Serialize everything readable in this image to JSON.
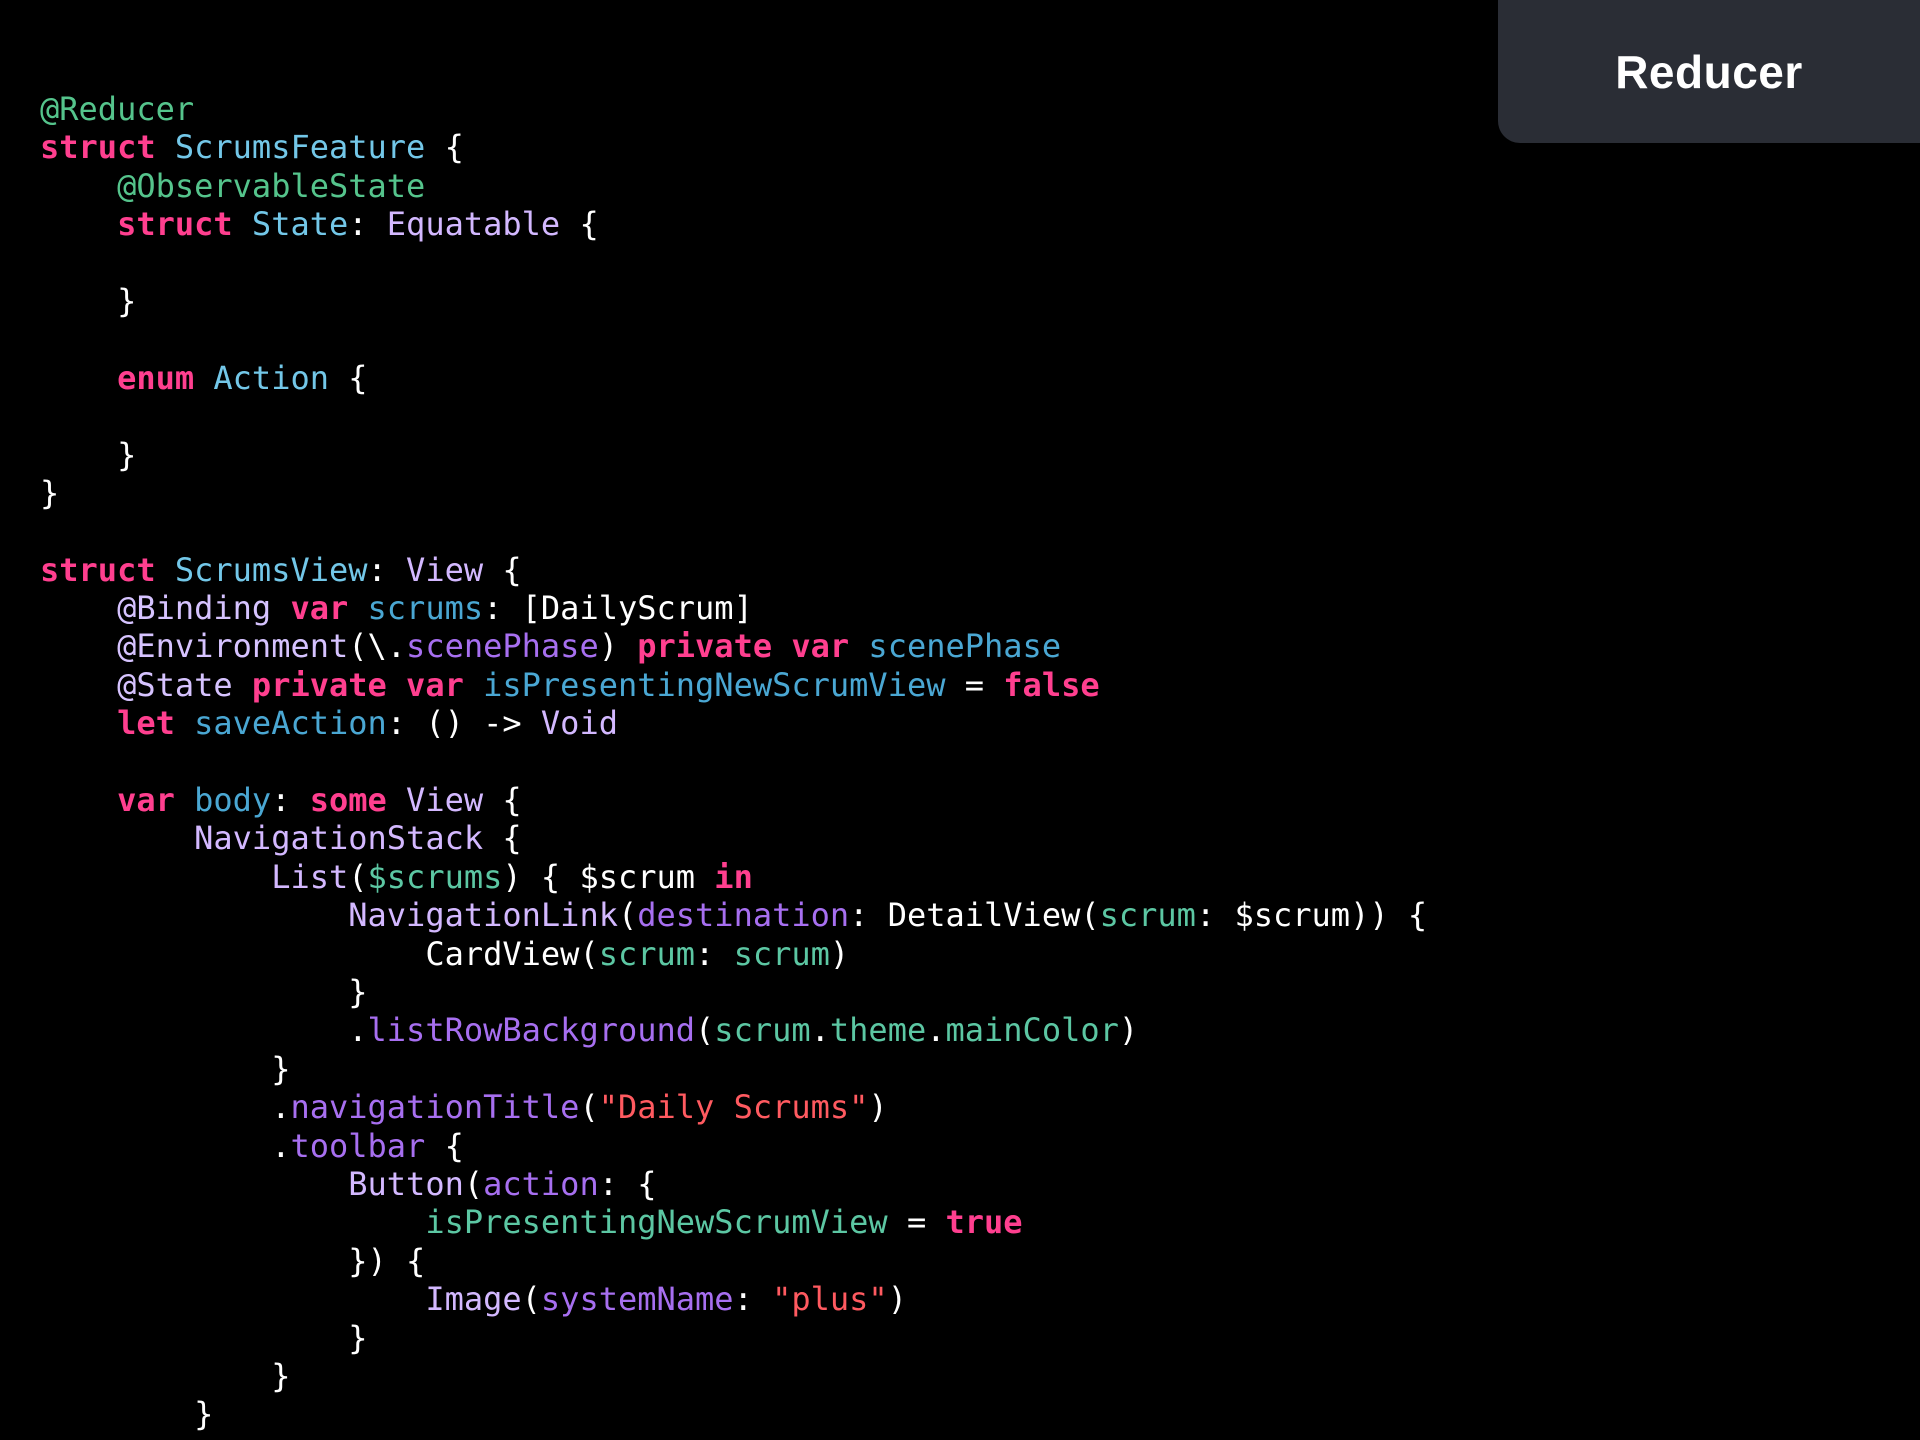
{
  "header": {
    "title": "Reducer"
  },
  "colors": {
    "background": "#000000",
    "badge_background": "#2a2d35",
    "keyword": "#ff3f8f",
    "decorator": "#55c48c",
    "attribute": "#d6c3ff",
    "type_declared": "#73c7e8",
    "type_system": "#d3b8ff",
    "identifier": "#4aa7d3",
    "function": "#a76ff0",
    "variable": "#5cc7a3",
    "string": "#ff5a60",
    "plain": "#ffffff"
  },
  "code": {
    "lines": [
      [
        {
          "t": "@Reducer",
          "c": "dec"
        }
      ],
      [
        {
          "t": "struct",
          "c": "kw"
        },
        {
          "t": " ",
          "c": "pln"
        },
        {
          "t": "ScrumsFeature",
          "c": "typ"
        },
        {
          "t": " {",
          "c": "pln"
        }
      ],
      [
        {
          "t": "    ",
          "c": "pln"
        },
        {
          "t": "@ObservableState",
          "c": "dec"
        }
      ],
      [
        {
          "t": "    ",
          "c": "pln"
        },
        {
          "t": "struct",
          "c": "kw"
        },
        {
          "t": " ",
          "c": "pln"
        },
        {
          "t": "State",
          "c": "typ"
        },
        {
          "t": ": ",
          "c": "pln"
        },
        {
          "t": "Equatable",
          "c": "std"
        },
        {
          "t": " {",
          "c": "pln"
        }
      ],
      [],
      [
        {
          "t": "    }",
          "c": "pln"
        }
      ],
      [],
      [
        {
          "t": "    ",
          "c": "pln"
        },
        {
          "t": "enum",
          "c": "kw"
        },
        {
          "t": " ",
          "c": "pln"
        },
        {
          "t": "Action",
          "c": "typ"
        },
        {
          "t": " {",
          "c": "pln"
        }
      ],
      [],
      [
        {
          "t": "    }",
          "c": "pln"
        }
      ],
      [
        {
          "t": "}",
          "c": "pln"
        }
      ],
      [],
      [
        {
          "t": "struct",
          "c": "kw"
        },
        {
          "t": " ",
          "c": "pln"
        },
        {
          "t": "ScrumsView",
          "c": "typ"
        },
        {
          "t": ": ",
          "c": "pln"
        },
        {
          "t": "View",
          "c": "std"
        },
        {
          "t": " {",
          "c": "pln"
        }
      ],
      [
        {
          "t": "    ",
          "c": "pln"
        },
        {
          "t": "@Binding",
          "c": "att"
        },
        {
          "t": " ",
          "c": "pln"
        },
        {
          "t": "var",
          "c": "kw"
        },
        {
          "t": " ",
          "c": "pln"
        },
        {
          "t": "scrums",
          "c": "id"
        },
        {
          "t": ": [",
          "c": "pln"
        },
        {
          "t": "DailyScrum",
          "c": "pln"
        },
        {
          "t": "]",
          "c": "pln"
        }
      ],
      [
        {
          "t": "    ",
          "c": "pln"
        },
        {
          "t": "@Environment",
          "c": "att"
        },
        {
          "t": "(\\.",
          "c": "pln"
        },
        {
          "t": "scenePhase",
          "c": "fn"
        },
        {
          "t": ") ",
          "c": "pln"
        },
        {
          "t": "private",
          "c": "kw"
        },
        {
          "t": " ",
          "c": "pln"
        },
        {
          "t": "var",
          "c": "kw"
        },
        {
          "t": " ",
          "c": "pln"
        },
        {
          "t": "scenePhase",
          "c": "id"
        }
      ],
      [
        {
          "t": "    ",
          "c": "pln"
        },
        {
          "t": "@State",
          "c": "att"
        },
        {
          "t": " ",
          "c": "pln"
        },
        {
          "t": "private",
          "c": "kw"
        },
        {
          "t": " ",
          "c": "pln"
        },
        {
          "t": "var",
          "c": "kw"
        },
        {
          "t": " ",
          "c": "pln"
        },
        {
          "t": "isPresentingNewScrumView",
          "c": "id"
        },
        {
          "t": " = ",
          "c": "pln"
        },
        {
          "t": "false",
          "c": "kw"
        }
      ],
      [
        {
          "t": "    ",
          "c": "pln"
        },
        {
          "t": "let",
          "c": "kw"
        },
        {
          "t": " ",
          "c": "pln"
        },
        {
          "t": "saveAction",
          "c": "id"
        },
        {
          "t": ": () -> ",
          "c": "pln"
        },
        {
          "t": "Void",
          "c": "std"
        }
      ],
      [],
      [
        {
          "t": "    ",
          "c": "pln"
        },
        {
          "t": "var",
          "c": "kw"
        },
        {
          "t": " ",
          "c": "pln"
        },
        {
          "t": "body",
          "c": "id"
        },
        {
          "t": ": ",
          "c": "pln"
        },
        {
          "t": "some",
          "c": "kw"
        },
        {
          "t": " ",
          "c": "pln"
        },
        {
          "t": "View",
          "c": "std"
        },
        {
          "t": " {",
          "c": "pln"
        }
      ],
      [
        {
          "t": "        ",
          "c": "pln"
        },
        {
          "t": "NavigationStack",
          "c": "std"
        },
        {
          "t": " {",
          "c": "pln"
        }
      ],
      [
        {
          "t": "            ",
          "c": "pln"
        },
        {
          "t": "List",
          "c": "std"
        },
        {
          "t": "(",
          "c": "pln"
        },
        {
          "t": "$scrums",
          "c": "var"
        },
        {
          "t": ") { $scrum ",
          "c": "pln"
        },
        {
          "t": "in",
          "c": "kw"
        }
      ],
      [
        {
          "t": "                ",
          "c": "pln"
        },
        {
          "t": "NavigationLink",
          "c": "std"
        },
        {
          "t": "(",
          "c": "pln"
        },
        {
          "t": "destination",
          "c": "fn"
        },
        {
          "t": ": ",
          "c": "pln"
        },
        {
          "t": "DetailView",
          "c": "pln"
        },
        {
          "t": "(",
          "c": "pln"
        },
        {
          "t": "scrum",
          "c": "var"
        },
        {
          "t": ": $scrum)) {",
          "c": "pln"
        }
      ],
      [
        {
          "t": "                    ",
          "c": "pln"
        },
        {
          "t": "CardView",
          "c": "pln"
        },
        {
          "t": "(",
          "c": "pln"
        },
        {
          "t": "scrum",
          "c": "var"
        },
        {
          "t": ": ",
          "c": "pln"
        },
        {
          "t": "scrum",
          "c": "var"
        },
        {
          "t": ")",
          "c": "pln"
        }
      ],
      [
        {
          "t": "                }",
          "c": "pln"
        }
      ],
      [
        {
          "t": "                .",
          "c": "pln"
        },
        {
          "t": "listRowBackground",
          "c": "fn"
        },
        {
          "t": "(",
          "c": "pln"
        },
        {
          "t": "scrum",
          "c": "var"
        },
        {
          "t": ".",
          "c": "pln"
        },
        {
          "t": "theme",
          "c": "var"
        },
        {
          "t": ".",
          "c": "pln"
        },
        {
          "t": "mainColor",
          "c": "var"
        },
        {
          "t": ")",
          "c": "pln"
        }
      ],
      [
        {
          "t": "            }",
          "c": "pln"
        }
      ],
      [
        {
          "t": "            .",
          "c": "pln"
        },
        {
          "t": "navigationTitle",
          "c": "fn"
        },
        {
          "t": "(",
          "c": "pln"
        },
        {
          "t": "\"Daily Scrums\"",
          "c": "str"
        },
        {
          "t": ")",
          "c": "pln"
        }
      ],
      [
        {
          "t": "            .",
          "c": "pln"
        },
        {
          "t": "toolbar",
          "c": "fn"
        },
        {
          "t": " {",
          "c": "pln"
        }
      ],
      [
        {
          "t": "                ",
          "c": "pln"
        },
        {
          "t": "Button",
          "c": "std"
        },
        {
          "t": "(",
          "c": "pln"
        },
        {
          "t": "action",
          "c": "fn"
        },
        {
          "t": ": {",
          "c": "pln"
        }
      ],
      [
        {
          "t": "                    ",
          "c": "pln"
        },
        {
          "t": "isPresentingNewScrumView",
          "c": "var"
        },
        {
          "t": " = ",
          "c": "pln"
        },
        {
          "t": "true",
          "c": "kw"
        }
      ],
      [
        {
          "t": "                }) {",
          "c": "pln"
        }
      ],
      [
        {
          "t": "                    ",
          "c": "pln"
        },
        {
          "t": "Image",
          "c": "std"
        },
        {
          "t": "(",
          "c": "pln"
        },
        {
          "t": "systemName",
          "c": "fn"
        },
        {
          "t": ": ",
          "c": "pln"
        },
        {
          "t": "\"plus\"",
          "c": "str"
        },
        {
          "t": ")",
          "c": "pln"
        }
      ],
      [
        {
          "t": "                }",
          "c": "pln"
        }
      ],
      [
        {
          "t": "            }",
          "c": "pln"
        }
      ],
      [
        {
          "t": "        }",
          "c": "pln"
        }
      ]
    ]
  }
}
